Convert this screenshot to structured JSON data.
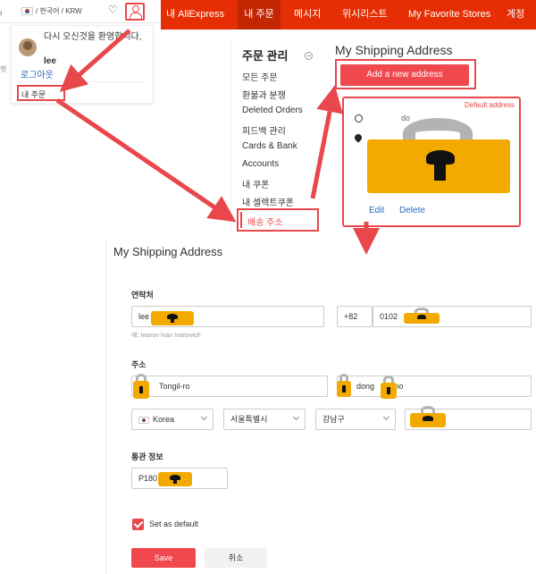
{
  "header": {
    "locale_text": "/ 한국어 / KRW",
    "truncated_text": "o",
    "side_fragment": "렛"
  },
  "account_dropdown": {
    "welcome": "다시 오신것을 환영합니다,",
    "username": "lee",
    "logout": "로그아웃",
    "my_orders": "내 주문"
  },
  "top_nav": {
    "items": [
      {
        "label": "내 AliExpress"
      },
      {
        "label": "내 주문"
      },
      {
        "label": "메시지"
      },
      {
        "label": "위시리스트"
      },
      {
        "label": "My Favorite Stores"
      },
      {
        "label": "계정"
      }
    ],
    "active_index": 1
  },
  "side_menu": {
    "title": "주문 관리",
    "items": [
      "모든 주문",
      "환불과 분쟁",
      "Deleted Orders",
      "피드백 관리",
      "Cards & Bank",
      "Accounts",
      "내 쿠폰",
      "내 셀렉트쿠폰"
    ],
    "selected": "배송 주소"
  },
  "address_panel": {
    "title": "My Shipping Address",
    "add_button": "Add a new address",
    "card": {
      "default_badge": "Default address",
      "fragment": "do",
      "edit": "Edit",
      "delete": "Delete"
    }
  },
  "form": {
    "title": "My Shipping Address",
    "contact_label": "연락처",
    "name_value": "lee",
    "name_hint": "예: Ivanov Ivan Ivanovich",
    "country_code": "+82",
    "phone_value": "0102",
    "address_label": "주소",
    "street_value": "Tongil-ro",
    "street2_a": "",
    "street2_b": "dong",
    "street2_c": "ho",
    "country_value": "Korea",
    "city_value": "서울특별시",
    "district_value": "강남구",
    "customs_label": "통관 정보",
    "customs_prefix": "P180",
    "customs_suffix": "0",
    "default_label": "Set as default",
    "save": "Save",
    "cancel": "취소"
  },
  "colors": {
    "nav_red": "#e62e04",
    "accent_red": "#f0484d",
    "annotation_red": "#e8474c",
    "lock_yellow": "#f2aa00",
    "link_blue": "#2a6ebb"
  }
}
